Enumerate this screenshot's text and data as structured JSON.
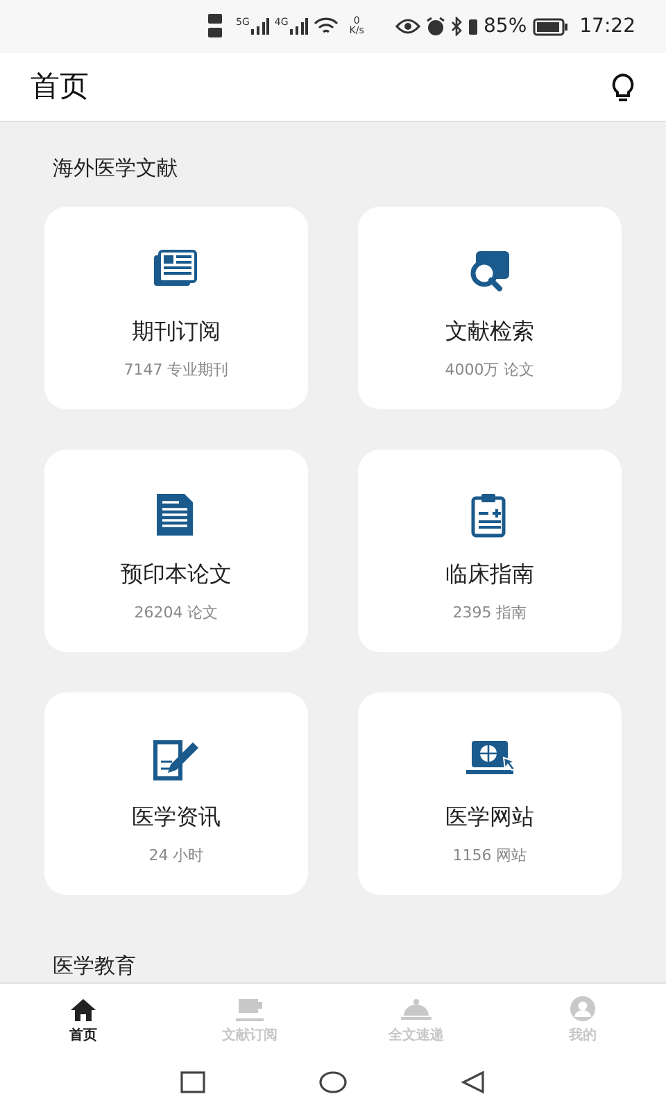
{
  "status_bar": {
    "network_5g": "5G",
    "network_4g": "4G",
    "speed_value": "0",
    "speed_unit": "K/s",
    "battery": "85%",
    "time": "17:22"
  },
  "header": {
    "title": "首页"
  },
  "sections": [
    {
      "title": "海外医学文献",
      "cards": [
        {
          "title": "期刊订阅",
          "subtitle": "7147 专业期刊"
        },
        {
          "title": "文献检索",
          "subtitle": "4000万 论文"
        },
        {
          "title": "预印本论文",
          "subtitle": "26204 论文"
        },
        {
          "title": "临床指南",
          "subtitle": "2395 指南"
        },
        {
          "title": "医学资讯",
          "subtitle": "24 小时"
        },
        {
          "title": "医学网站",
          "subtitle": "1156 网站"
        }
      ]
    },
    {
      "title": "医学教育"
    }
  ],
  "bottom_nav": [
    {
      "label": "首页",
      "selected": true
    },
    {
      "label": "文献订阅",
      "selected": false
    },
    {
      "label": "全文速递",
      "selected": false
    },
    {
      "label": "我的",
      "selected": false
    }
  ]
}
